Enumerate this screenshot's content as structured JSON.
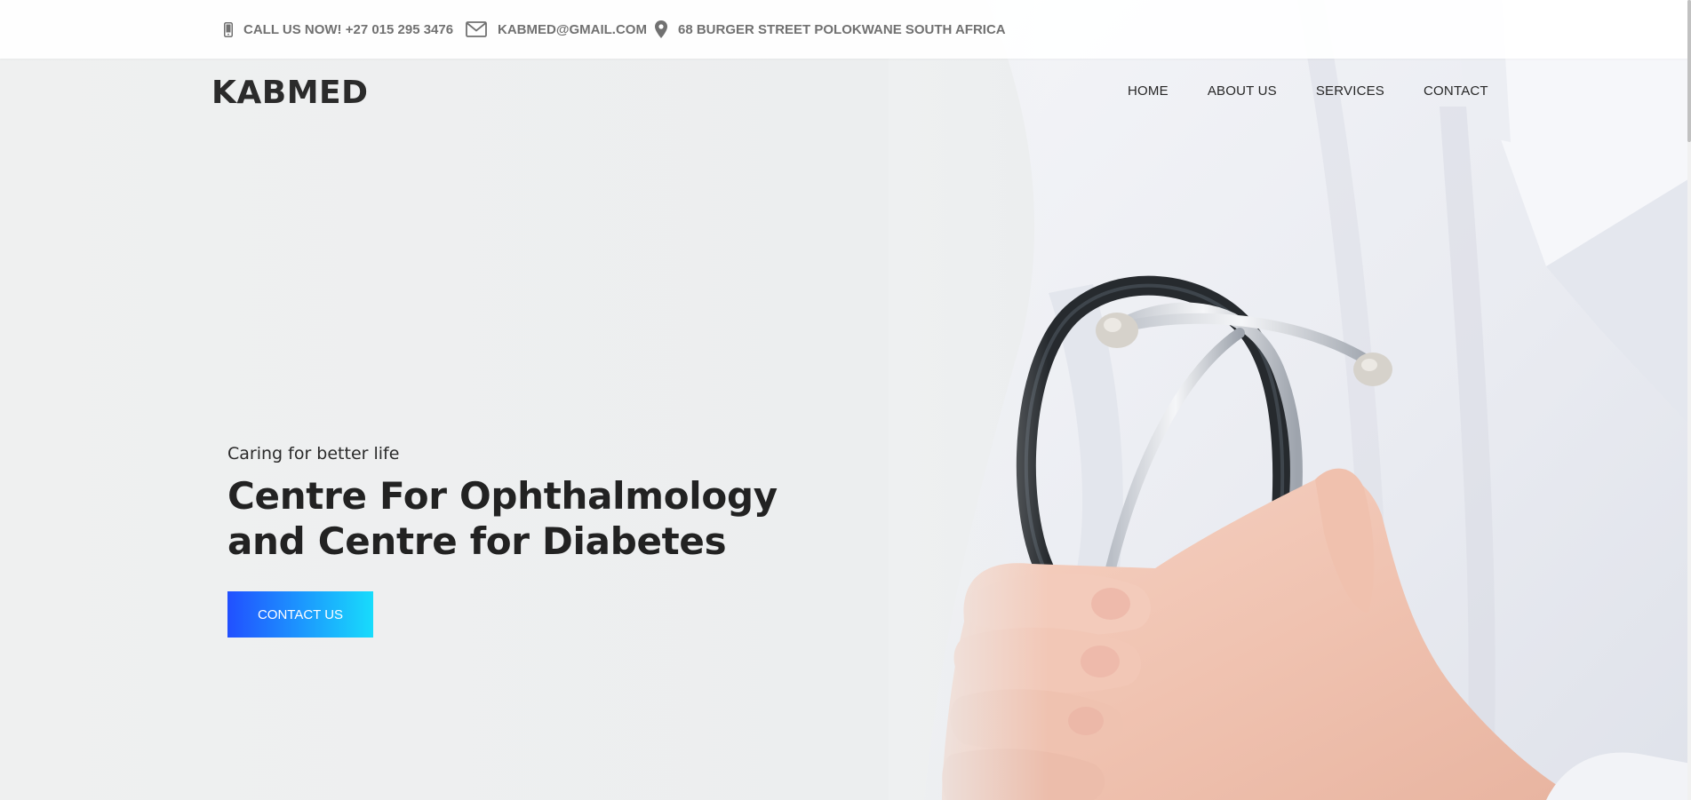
{
  "topbar": {
    "phone_text": "CALL US NOW! +27 015 295 3476",
    "phone_icon": "mobile-phone-icon",
    "email_text": "KABMED@GMAIL.COM",
    "email_icon": "envelope-icon",
    "address_text": "68 BURGER STREET POLOKWANE SOUTH AFRICA",
    "address_icon": "map-pin-icon"
  },
  "header": {
    "logo": "KABMED",
    "nav": [
      {
        "label": "HOME"
      },
      {
        "label": "ABOUT US"
      },
      {
        "label": "SERVICES"
      },
      {
        "label": "CONTACT"
      }
    ]
  },
  "hero": {
    "tagline": "Caring for better life",
    "headline_line1": "Centre For Ophthalmology",
    "headline_line2": "and Centre for Diabetes",
    "cta_label": "CONTACT US",
    "image_subject": "doctor-in-white-coat-with-stethoscope"
  },
  "colors": {
    "accent_gradient_start": "#2150ff",
    "accent_gradient_end": "#18dcfc",
    "text_dark": "#222222",
    "topbar_text": "#717171"
  }
}
